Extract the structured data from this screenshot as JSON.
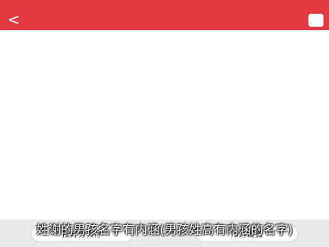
{
  "header": {
    "back_glyph": "<",
    "action_label": "",
    "accent_color": "#e23a3f"
  },
  "names": [],
  "bottom_bar": {
    "left_label": "按好分排序",
    "right_label": "筛选设置"
  },
  "caption": "姓谢的男孩名字有内涵(男孩姓高有内涵的名字)"
}
